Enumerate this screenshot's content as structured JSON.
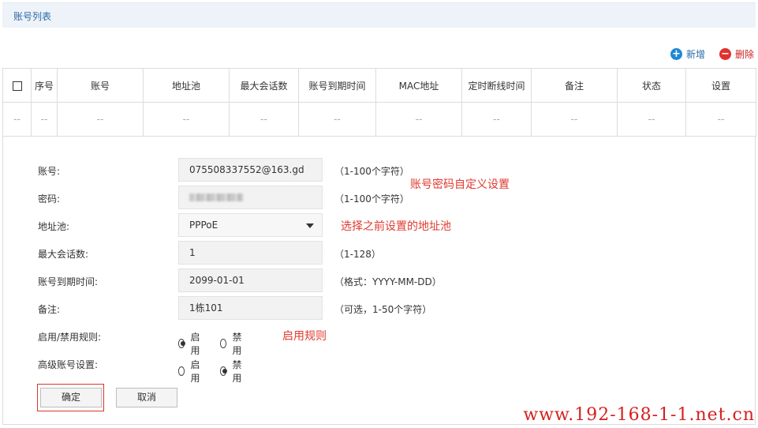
{
  "header": {
    "title": "账号列表"
  },
  "toolbar": {
    "add_label": "新增",
    "delete_label": "删除"
  },
  "table": {
    "columns": [
      "序号",
      "账号",
      "地址池",
      "最大会话数",
      "账号到期时间",
      "MAC地址",
      "定时断线时间",
      "备注",
      "状态",
      "设置"
    ],
    "empty_row": [
      "--",
      "--",
      "--",
      "--",
      "--",
      "--",
      "--",
      "--",
      "--",
      "--",
      "--"
    ]
  },
  "form": {
    "account": {
      "label": "账号:",
      "value": "075508337552@163.gd",
      "hint": "（1-100个字符）"
    },
    "password": {
      "label": "密码:",
      "hint": "（1-100个字符）"
    },
    "pool": {
      "label": "地址池:",
      "value": "PPPoE"
    },
    "max_sessions": {
      "label": "最大会话数:",
      "value": "1",
      "hint": "（1-128）"
    },
    "expire": {
      "label": "账号到期时间:",
      "value": "2099-01-01",
      "hint": "（格式：YYYY-MM-DD）"
    },
    "remark": {
      "label": "备注:",
      "value": "1栋101",
      "hint": "（可选，1-50个字符）"
    },
    "rule": {
      "label": "启用/禁用规则:",
      "enable": "启用",
      "disable": "禁用",
      "selected": "启用"
    },
    "advanced": {
      "label": "高级账号设置:",
      "enable": "启用",
      "disable": "禁用",
      "selected": "禁用"
    },
    "ok_label": "确定",
    "cancel_label": "取消"
  },
  "annotations": {
    "password_note": "账号密码自定义设置",
    "pool_note": "选择之前设置的地址池",
    "rule_note": "启用规则"
  },
  "watermark": "www.192-168-1-1.net.cn",
  "colors": {
    "accent_blue": "#1e88d6",
    "danger_red": "#e0312f",
    "annotation_red": "#e03a2f"
  }
}
